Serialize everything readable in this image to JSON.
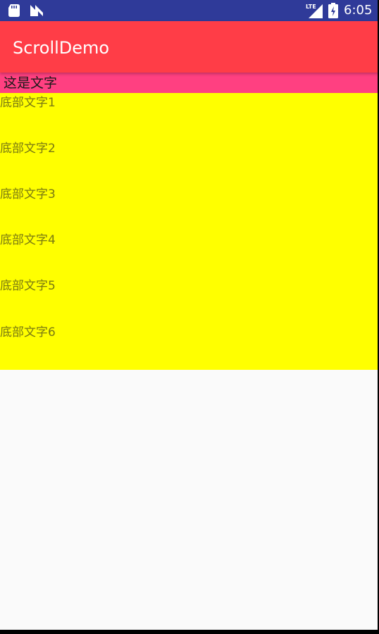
{
  "status_bar": {
    "time": "6:05",
    "network_label": "LTE",
    "icons": [
      "sd-card-icon",
      "n-notification-icon",
      "lte-signal-icon",
      "battery-icon"
    ],
    "background": "#2f3a99"
  },
  "toolbar": {
    "title": "ScrollDemo",
    "background": "#ff3d47"
  },
  "header": {
    "text": "这是文字",
    "background": "#ff4081"
  },
  "list": {
    "background": "#ffff00",
    "items": [
      {
        "label": "底部文字1"
      },
      {
        "label": "底部文字2"
      },
      {
        "label": "底部文字3"
      },
      {
        "label": "底部文字4"
      },
      {
        "label": "底部文字5"
      },
      {
        "label": "底部文字6"
      }
    ]
  }
}
